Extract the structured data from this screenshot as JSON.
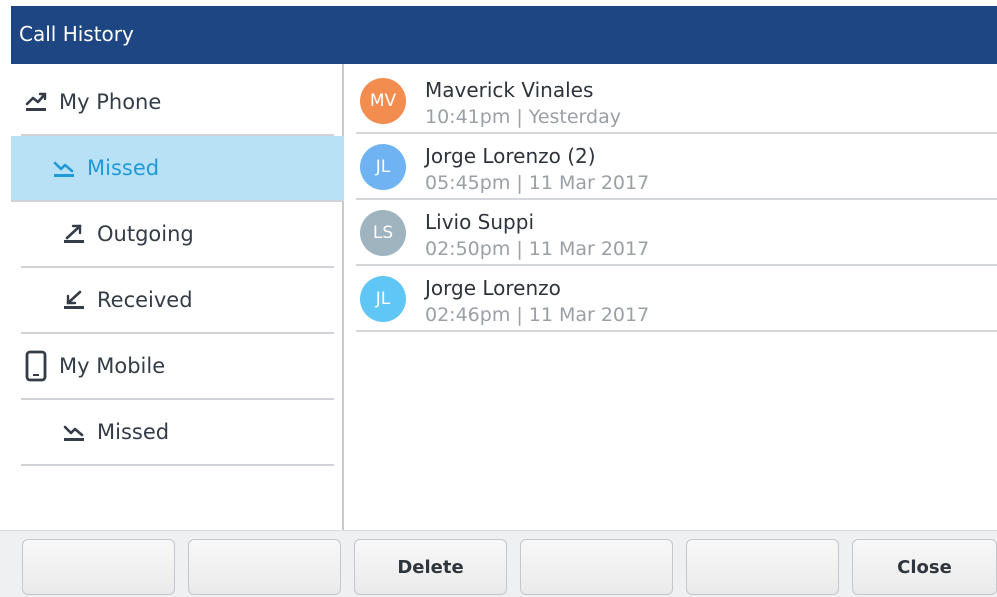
{
  "window": {
    "title": "Call History"
  },
  "sidebar": {
    "items": [
      {
        "label": "My Phone",
        "icon": "phone-missed-icon"
      },
      {
        "label": "Missed",
        "icon": "missed-call-icon",
        "selected": true
      },
      {
        "label": "Outgoing",
        "icon": "outgoing-call-icon"
      },
      {
        "label": "Received",
        "icon": "received-call-icon"
      },
      {
        "label": "My Mobile",
        "icon": "mobile-phone-icon"
      },
      {
        "label": "Missed",
        "icon": "missed-call-icon"
      }
    ]
  },
  "calls": [
    {
      "initials": "MV",
      "name": "Maverick Vinales",
      "time": "10:41pm",
      "date": "Yesterday",
      "avatar_color": "#f28d4f"
    },
    {
      "initials": "JL",
      "name": "Jorge Lorenzo (2)",
      "time": "05:45pm",
      "date": "11 Mar 2017",
      "avatar_color": "#6fb3f2"
    },
    {
      "initials": "LS",
      "name": "Livio Suppi",
      "time": "02:50pm",
      "date": "11 Mar 2017",
      "avatar_color": "#9fb4bf"
    },
    {
      "initials": "JL",
      "name": "Jorge Lorenzo",
      "time": "02:46pm",
      "date": "11 Mar 2017",
      "avatar_color": "#5fc6f5"
    }
  ],
  "meta_separator": "|",
  "softkeys": [
    "",
    "",
    "Delete",
    "",
    "",
    "Close"
  ],
  "colors": {
    "titlebar": "#1e4683",
    "selected_bg": "#b9e1f6",
    "selected_text": "#1e9ad8"
  }
}
